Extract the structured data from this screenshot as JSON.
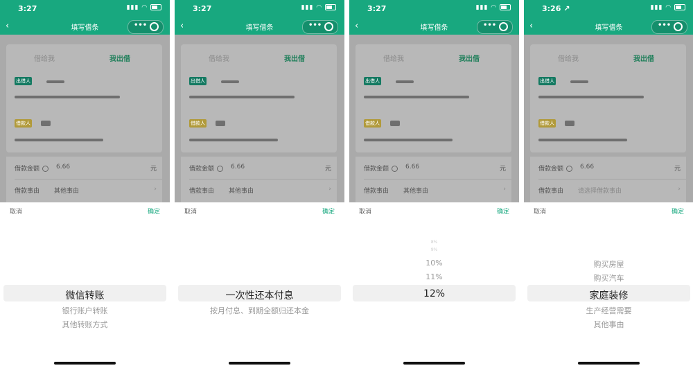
{
  "screens": [
    {
      "status": {
        "time": "3:27"
      },
      "header": {
        "back": "‹",
        "title": "填写借条"
      },
      "form": {
        "tab_left": "借给我",
        "tab_right": "我出借",
        "lender_tag": "出借人",
        "borrower_tag": "借款人",
        "amount_label": "借款金额",
        "amount_value": "6.66",
        "amount_unit": "元",
        "purpose_label": "借款事由",
        "purpose_value": "其他事由"
      },
      "picker": {
        "cancel": "取消",
        "confirm": "确定",
        "options_above": [],
        "selected": "微信转账",
        "options_below": [
          "银行账户转账",
          "其他转账方式"
        ]
      }
    },
    {
      "status": {
        "time": "3:27"
      },
      "header": {
        "back": "‹",
        "title": "填写借条"
      },
      "form": {
        "tab_left": "借给我",
        "tab_right": "我出借",
        "lender_tag": "出借人",
        "borrower_tag": "借款人",
        "amount_label": "借款金额",
        "amount_value": "6.66",
        "amount_unit": "元",
        "purpose_label": "借款事由",
        "purpose_value": "其他事由"
      },
      "picker": {
        "cancel": "取消",
        "confirm": "确定",
        "options_above": [],
        "selected": "一次性还本付息",
        "options_below": [
          "按月付息、到期全额归还本金"
        ]
      }
    },
    {
      "status": {
        "time": "3:27"
      },
      "header": {
        "back": "‹",
        "title": "填写借条"
      },
      "form": {
        "tab_left": "借给我",
        "tab_right": "我出借",
        "lender_tag": "出借人",
        "borrower_tag": "借款人",
        "amount_label": "借款金额",
        "amount_value": "6.66",
        "amount_unit": "元",
        "purpose_label": "借款事由",
        "purpose_value": "其他事由"
      },
      "picker": {
        "cancel": "取消",
        "confirm": "确定",
        "options_above": [
          "8%",
          "9%",
          "10%",
          "11%"
        ],
        "selected": "12%",
        "options_below": []
      }
    },
    {
      "status": {
        "time": "3:26 ↗"
      },
      "header": {
        "back": "‹",
        "title": "填写借条"
      },
      "form": {
        "tab_left": "借给我",
        "tab_right": "我出借",
        "lender_tag": "出借人",
        "borrower_tag": "借款人",
        "amount_label": "借款金额",
        "amount_value": "6.66",
        "amount_unit": "元",
        "purpose_label": "借款事由",
        "purpose_value": "请选择借款事由"
      },
      "picker": {
        "cancel": "取消",
        "confirm": "确定",
        "options_above": [
          "购买房屋",
          "购买汽车"
        ],
        "selected": "家庭装修",
        "options_below": [
          "生产经营需要",
          "其他事由"
        ]
      }
    }
  ],
  "colors": {
    "accent": "#18a87f",
    "lender_tag": "#157a62",
    "borrower_tag": "#b19a3a"
  },
  "icons": {
    "back": "chevron-left-icon",
    "more": "more-dots-icon",
    "close": "target-circle-icon",
    "info": "info-icon",
    "chevron": "chevron-right-icon"
  }
}
